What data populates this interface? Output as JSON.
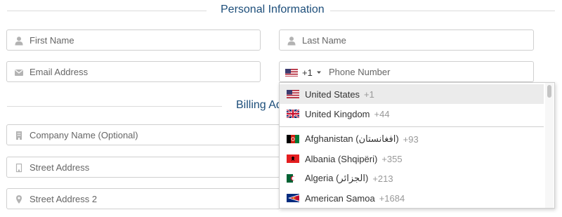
{
  "personal_section": {
    "title": "Personal Information"
  },
  "billing_section": {
    "title": "Billing Ad"
  },
  "fields": {
    "first_name": {
      "placeholder": "First Name",
      "icon": "user-icon"
    },
    "last_name": {
      "placeholder": "Last Name",
      "icon": "user-icon"
    },
    "email": {
      "placeholder": "Email Address",
      "icon": "envelope-icon"
    },
    "phone": {
      "placeholder": "Phone Number",
      "selected_code": "+1",
      "selected_flag": "us-flag-icon"
    },
    "company": {
      "placeholder": "Company Name (Optional)",
      "icon": "building-icon"
    },
    "street": {
      "placeholder": "Street Address",
      "icon": "building-outline-icon"
    },
    "street2": {
      "placeholder": "Street Address 2",
      "icon": "map-pin-icon"
    }
  },
  "country_dropdown": {
    "preferred": [
      {
        "name": "United States",
        "dial": "+1",
        "flag": "us-flag-icon",
        "highlighted": true
      },
      {
        "name": "United Kingdom",
        "dial": "+44",
        "flag": "uk-flag-icon",
        "highlighted": false
      }
    ],
    "countries": [
      {
        "name": "Afghanistan (افغانستان‎)",
        "dial": "+93",
        "flag": "afghanistan-flag-icon"
      },
      {
        "name": "Albania (Shqipëri)",
        "dial": "+355",
        "flag": "albania-flag-icon"
      },
      {
        "name": "Algeria (الجزائر‎)",
        "dial": "+213",
        "flag": "algeria-flag-icon"
      },
      {
        "name": "American Samoa",
        "dial": "+1684",
        "flag": "american-samoa-flag-icon"
      }
    ]
  },
  "colors": {
    "section_title": "#1d4e7a",
    "border": "#cfcfcf",
    "highlight": "#ebebeb",
    "icon": "#b3b3b3"
  }
}
